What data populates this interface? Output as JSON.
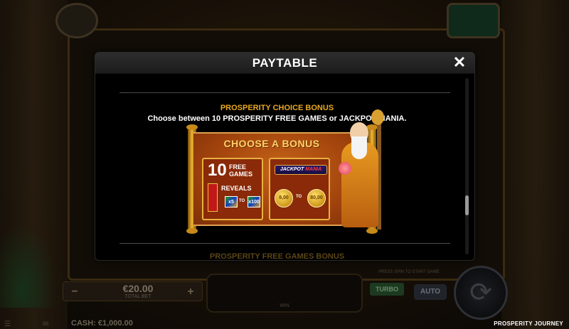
{
  "modal": {
    "title": "PAYTABLE",
    "close_label": "✕",
    "section_title": "PROSPERITY CHOICE BONUS",
    "section_description": "Choose between 10 PROSPERITY FREE GAMES or JACKPOT MANIA.",
    "next_section_title": "PROSPERITY FREE GAMES BONUS",
    "scroll_position": 0.75
  },
  "bonus_image": {
    "title": "CHOOSE A BONUS",
    "free_games_count": "10",
    "free_games_label": "FREE GAMES",
    "reveals_label": "REVEALS",
    "mult_min": "x5",
    "mult_to": "TO",
    "mult_max": "x100",
    "jackpot_logo_a": "JACKPOT",
    "jackpot_logo_b": "MANIA",
    "coin_min": "8,00",
    "coin_to": "TO",
    "coin_max": "80,00"
  },
  "controls": {
    "bet_minus": "−",
    "bet_plus": "+",
    "bet_value": "€20.00",
    "bet_label": "TOTAL BET",
    "win_label": "WIN",
    "stake_text": "PRESS SPIN TO START GAME",
    "turbo_label": "TURBO",
    "auto_label": "AUTO",
    "cash_label": "CASH: €1,000.00",
    "game_name": "PROSPERITY JOURNEY"
  },
  "colors": {
    "accent_gold": "#e8a820",
    "modal_bg": "#000000"
  }
}
